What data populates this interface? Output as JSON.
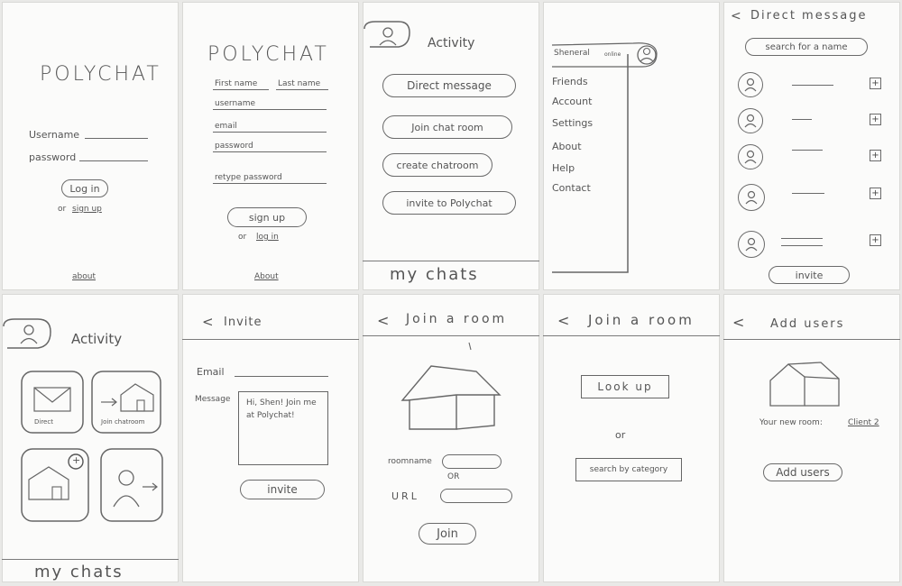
{
  "s1": {
    "title": "POLYCHAT",
    "username": "Username",
    "password": "password",
    "login": "Log in",
    "or": "or",
    "signup": "sign up",
    "about": "about"
  },
  "s2": {
    "title": "POLYCHAT",
    "first": "First name",
    "last": "Last name",
    "username": "username",
    "email": "email",
    "password": "password",
    "retype": "retype password",
    "signup": "sign up",
    "or": "or",
    "login": "log in",
    "about": "About"
  },
  "s3": {
    "title": "Activity",
    "items": [
      "Direct message",
      "Join chat room",
      "create chatroom",
      "invite to Polychat"
    ],
    "mychats": "my chats"
  },
  "s4": {
    "user": "Sheneral",
    "status": "online",
    "menu": [
      "Friends",
      "Account",
      "Settings",
      "About",
      "Help",
      "Contact"
    ]
  },
  "s5": {
    "back": "<",
    "title": "Direct message",
    "search_placeholder": "search for a name",
    "invite": "invite",
    "plus": "+"
  },
  "s6": {
    "title": "Activity",
    "tile1": "Direct",
    "tile2": "Join chatroom",
    "mychats": "my chats",
    "plus": "+"
  },
  "s7": {
    "back": "<",
    "title": "Invite",
    "email": "Email",
    "message": "Message",
    "message_text": "Hi, Shen! Join me at Polychat!",
    "invite": "invite"
  },
  "s8": {
    "back": "<",
    "title": "Join a room",
    "roomname": "roomname",
    "or": "OR",
    "url": "URL",
    "join": "Join"
  },
  "s9": {
    "back": "<",
    "title": "Join a room",
    "lookup": "Look up",
    "or": "or",
    "category": "search by category"
  },
  "s10": {
    "back": "<",
    "title": "Add users",
    "newroom_label": "Your new room:",
    "newroom_value": "Client 2",
    "addusers": "Add users"
  }
}
